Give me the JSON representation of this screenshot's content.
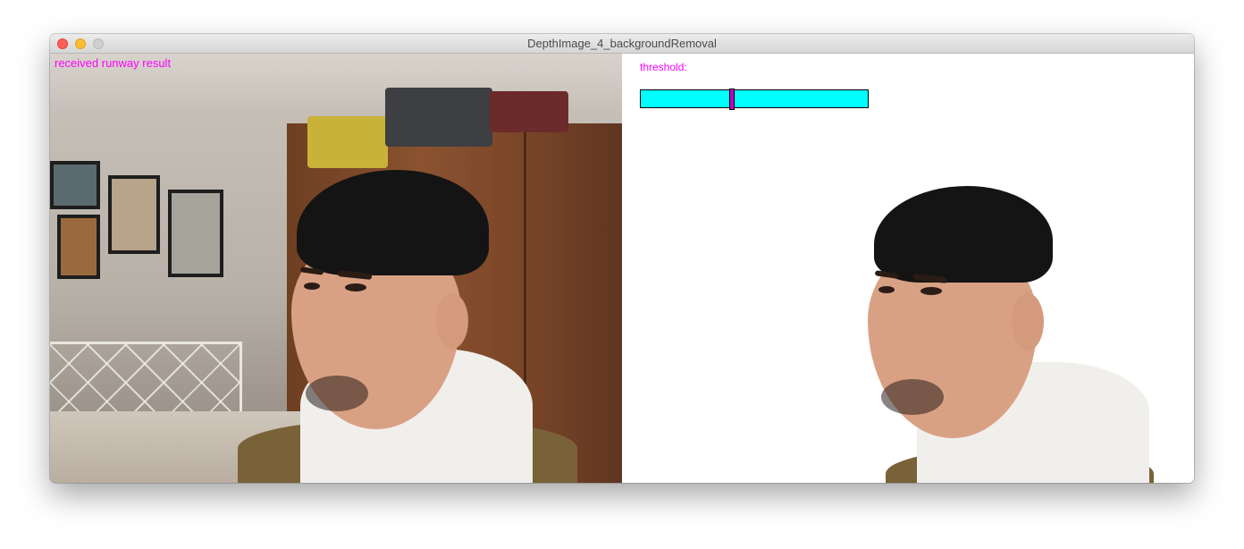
{
  "window": {
    "title": "DepthImage_4_backgroundRemoval"
  },
  "camera_view": {
    "status_text": "received runway result",
    "status_color": "#ff00ff"
  },
  "result_view": {
    "threshold_label": "threshold:",
    "slider": {
      "value_fraction": 0.4,
      "track_color": "#00ffff",
      "handle_color": "#c000c0"
    }
  }
}
